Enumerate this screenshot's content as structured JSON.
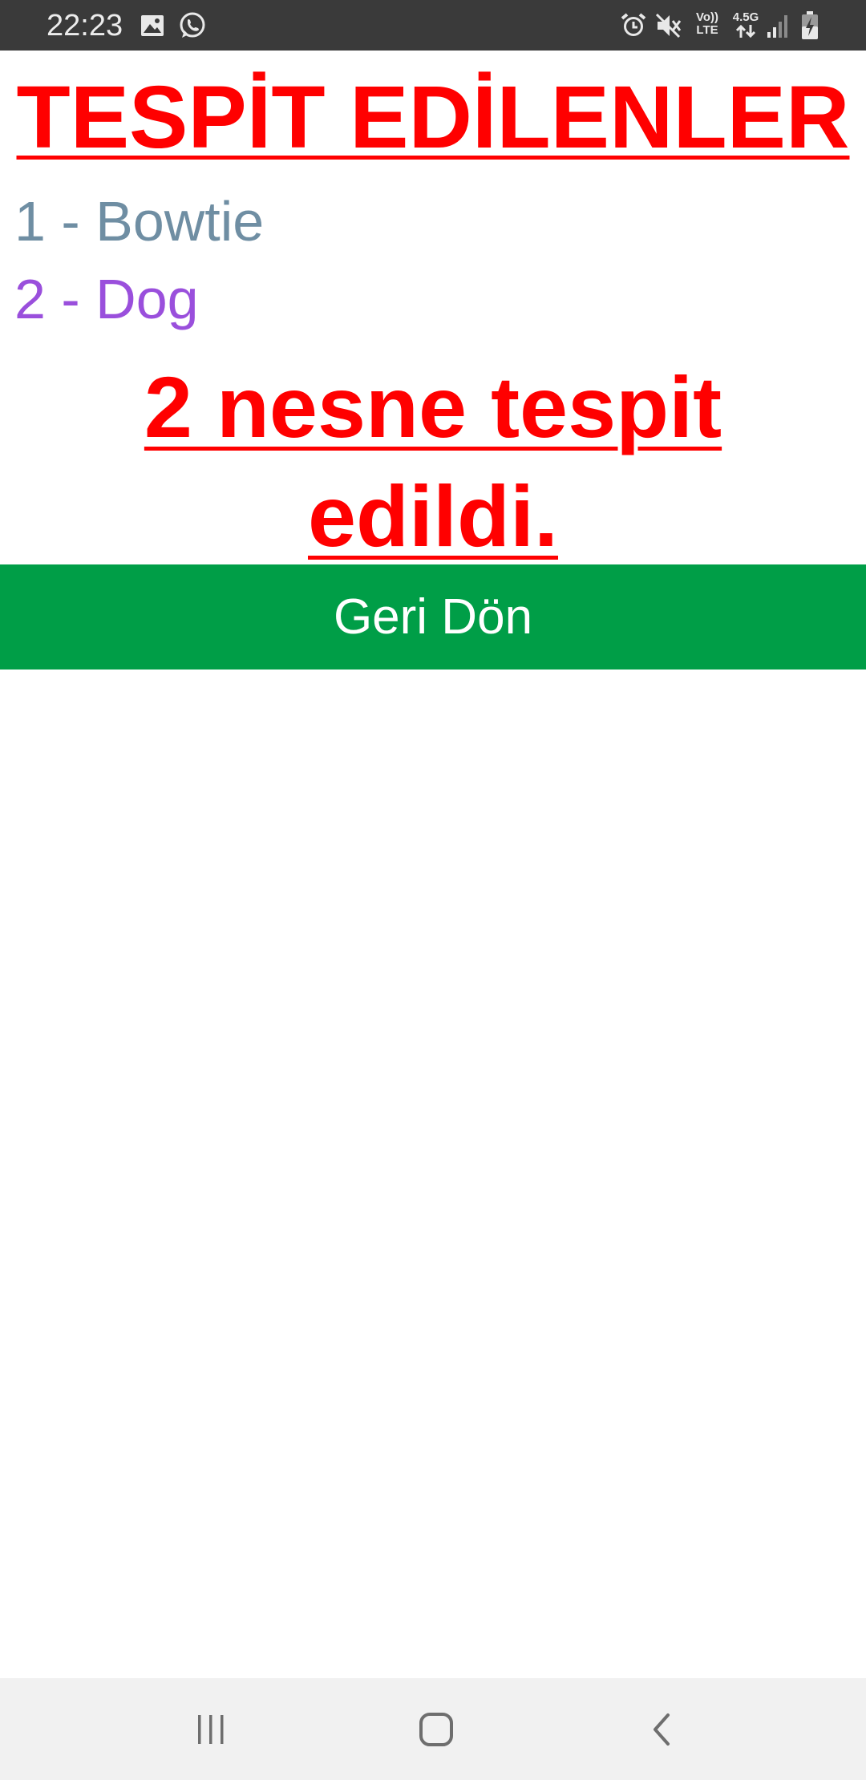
{
  "status_bar": {
    "time": "22:23",
    "notification_icons": [
      "image-icon",
      "whatsapp-icon"
    ],
    "system_icons": [
      "alarm-icon",
      "mute-icon",
      "volte-icon",
      "network-4.5g-icon",
      "signal-icon",
      "battery-charging-icon"
    ],
    "volte_line1": "Vo))",
    "volte_line2": "LTE",
    "network_label": "4.5G"
  },
  "page": {
    "title": "TESPİT EDİLENLER",
    "detections": [
      {
        "label": "1 - Bowtie",
        "color": "#6f8ea3"
      },
      {
        "label": "2 - Dog",
        "color": "#9a4fdc"
      }
    ],
    "summary": "2 nesne tespit edildi.",
    "back_button_label": "Geri Dön"
  },
  "colors": {
    "title": "#ff0000",
    "button_bg": "#009e47",
    "button_text": "#ffffff",
    "status_bar_bg": "#3a3a3a",
    "nav_bar_bg": "#f1f1f1"
  },
  "nav_bar": {
    "buttons": [
      "recent-apps-icon",
      "home-icon",
      "back-icon"
    ]
  }
}
